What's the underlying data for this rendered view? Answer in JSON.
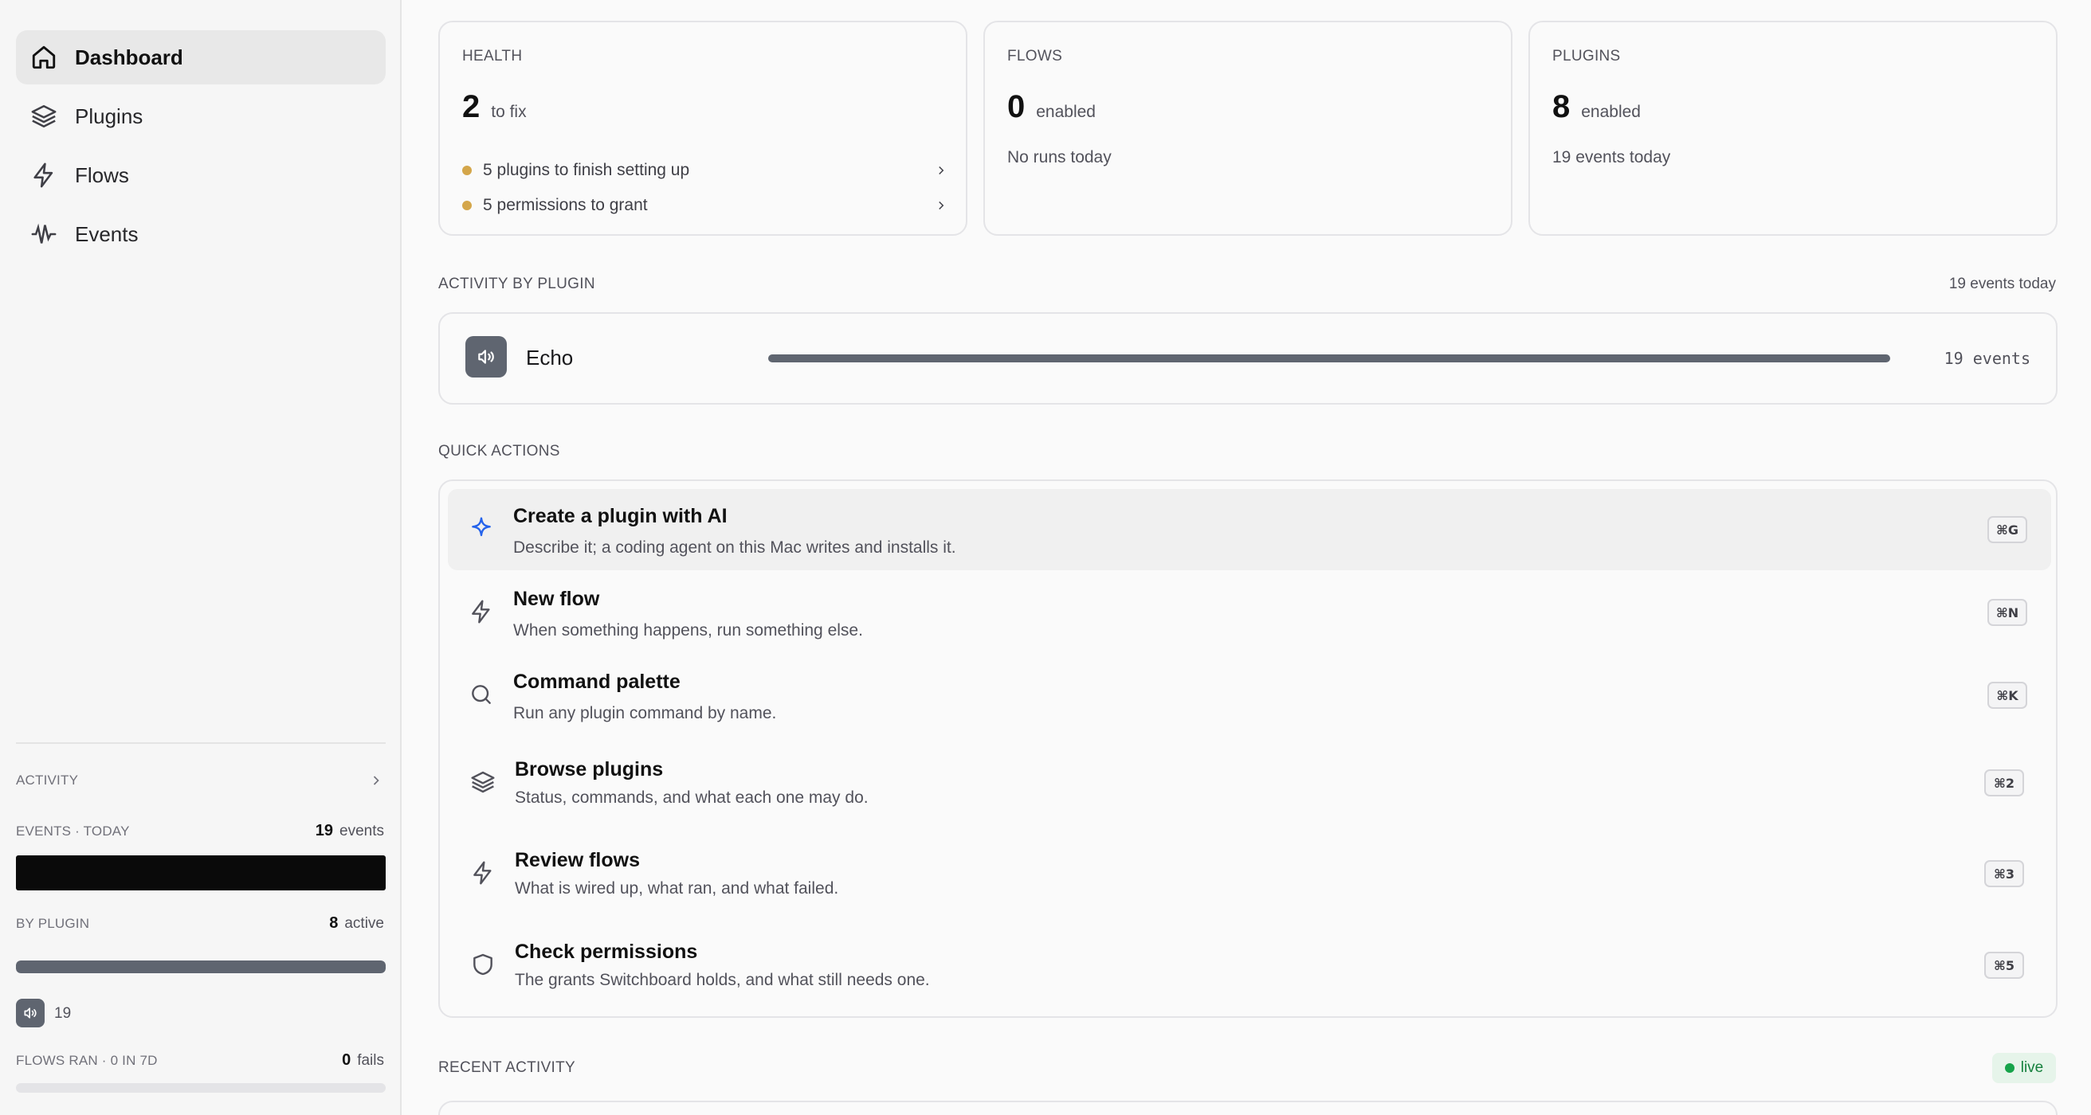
{
  "sidebar": {
    "nav": [
      {
        "label": "Dashboard",
        "icon": "home-icon",
        "active": true
      },
      {
        "label": "Plugins",
        "icon": "layers-icon"
      },
      {
        "label": "Flows",
        "icon": "lightning-icon"
      },
      {
        "label": "Events",
        "icon": "waveform-icon"
      }
    ],
    "activity": {
      "title": "ACTIVITY",
      "events_label": "EVENTS · TODAY",
      "events_value": "19",
      "events_unit": "events",
      "by_plugin_label": "BY PLUGIN",
      "by_plugin_value": "8",
      "by_plugin_unit": "active",
      "plugin_count": "19",
      "flows_label": "FLOWS RAN · 0 IN 7D",
      "flows_value": "0",
      "flows_unit": "fails"
    }
  },
  "cards": {
    "health": {
      "label": "HEALTH",
      "value": "2",
      "unit": "to fix",
      "items": [
        "5 plugins to finish setting up",
        "5 permissions to grant"
      ]
    },
    "flows": {
      "label": "FLOWS",
      "value": "0",
      "unit": "enabled",
      "sub": "No runs today"
    },
    "plugins": {
      "label": "PLUGINS",
      "value": "8",
      "unit": "enabled",
      "sub": "19 events today"
    }
  },
  "activity_by_plugin": {
    "title": "ACTIVITY BY PLUGIN",
    "summary": "19 events today",
    "rows": [
      {
        "name": "Echo",
        "count": "19 events",
        "share": 1.0
      }
    ]
  },
  "quick_actions": {
    "title": "QUICK ACTIONS",
    "items": [
      {
        "title": "Create a plugin with AI",
        "desc": "Describe it; a coding agent on this Mac writes and installs it.",
        "shortcut": "⌘G",
        "icon": "sparkle-icon"
      },
      {
        "title": "New flow",
        "desc": "When something happens, run something else.",
        "shortcut": "⌘N",
        "icon": "lightning-icon"
      },
      {
        "title": "Command palette",
        "desc": "Run any plugin command by name.",
        "shortcut": "⌘K",
        "icon": "search-icon"
      },
      {
        "title": "Browse plugins",
        "desc": "Status, commands, and what each one may do.",
        "shortcut": "⌘2",
        "icon": "layers-icon"
      },
      {
        "title": "Review flows",
        "desc": "What is wired up, what ran, and what failed.",
        "shortcut": "⌘3",
        "icon": "lightning-icon"
      },
      {
        "title": "Check permissions",
        "desc": "The grants Switchboard holds, and what still needs one.",
        "shortcut": "⌘5",
        "icon": "shield-icon"
      }
    ]
  },
  "recent_activity": {
    "title": "RECENT ACTIVITY",
    "status": "live"
  },
  "colors": {
    "accent": "#2563eb",
    "bar": "#5f6570",
    "warn_dot": "#d4a64a",
    "live": "#16a34a"
  }
}
